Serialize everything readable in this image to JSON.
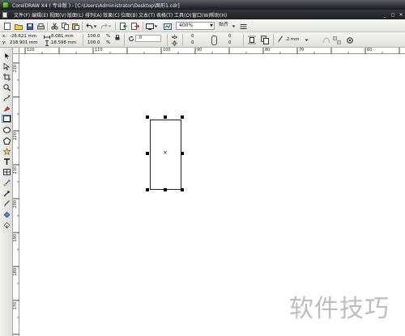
{
  "window": {
    "title": "CorelDRAW X4 ( 专业版 ) - [C:\\Users\\Administrator\\Desktop\\图形1.cdr]",
    "controls": [
      "_",
      "◻",
      "✕"
    ]
  },
  "menu": {
    "items": [
      "文件(F)",
      "编辑(E)",
      "视图(V)",
      "版面(L)",
      "排列(A)",
      "效果(C)",
      "位图(B)",
      "文本(T)",
      "表格(T)",
      "工具(O)",
      "窗口(W)",
      "帮助(H)"
    ]
  },
  "standard_toolbar": {
    "zoom_level": "400%",
    "snap_label": "贴齐"
  },
  "property_bar": {
    "x_label": "x:",
    "x_value": "-26.621 mm",
    "y_label": "y:",
    "y_value": "218.901 mm",
    "width_value": "8.081 mm",
    "height_value": "18.598 mm",
    "scale_x": "100.0",
    "scale_y": "100.0",
    "percent": "%",
    "rotation_value": ".0",
    "corner_values": [
      "0",
      "0",
      "0",
      "0"
    ],
    "outline_width": ".2 mm"
  },
  "rulers": {
    "horizontal_ticks": [
      "120",
      "110",
      "100",
      "90",
      "80",
      "70",
      "60"
    ],
    "vertical_ticks": [
      "230",
      "220",
      "210",
      "200",
      "190",
      "180",
      "170"
    ]
  },
  "toolbox": {
    "tools": [
      "pick-tool-icon",
      "shape-tool-icon",
      "crop-tool-icon",
      "zoom-tool-icon",
      "freehand-tool-icon",
      "smart-fill-tool-icon",
      "rectangle-tool-icon",
      "ellipse-tool-icon",
      "polygon-tool-icon",
      "basic-shapes-tool-icon",
      "text-tool-icon",
      "table-tool-icon",
      "interactive-tool-icon",
      "eyedropper-tool-icon",
      "outline-tool-icon",
      "fill-tool-icon",
      "interactive-fill-tool-icon"
    ]
  },
  "watermark": {
    "text": "软件技巧"
  }
}
